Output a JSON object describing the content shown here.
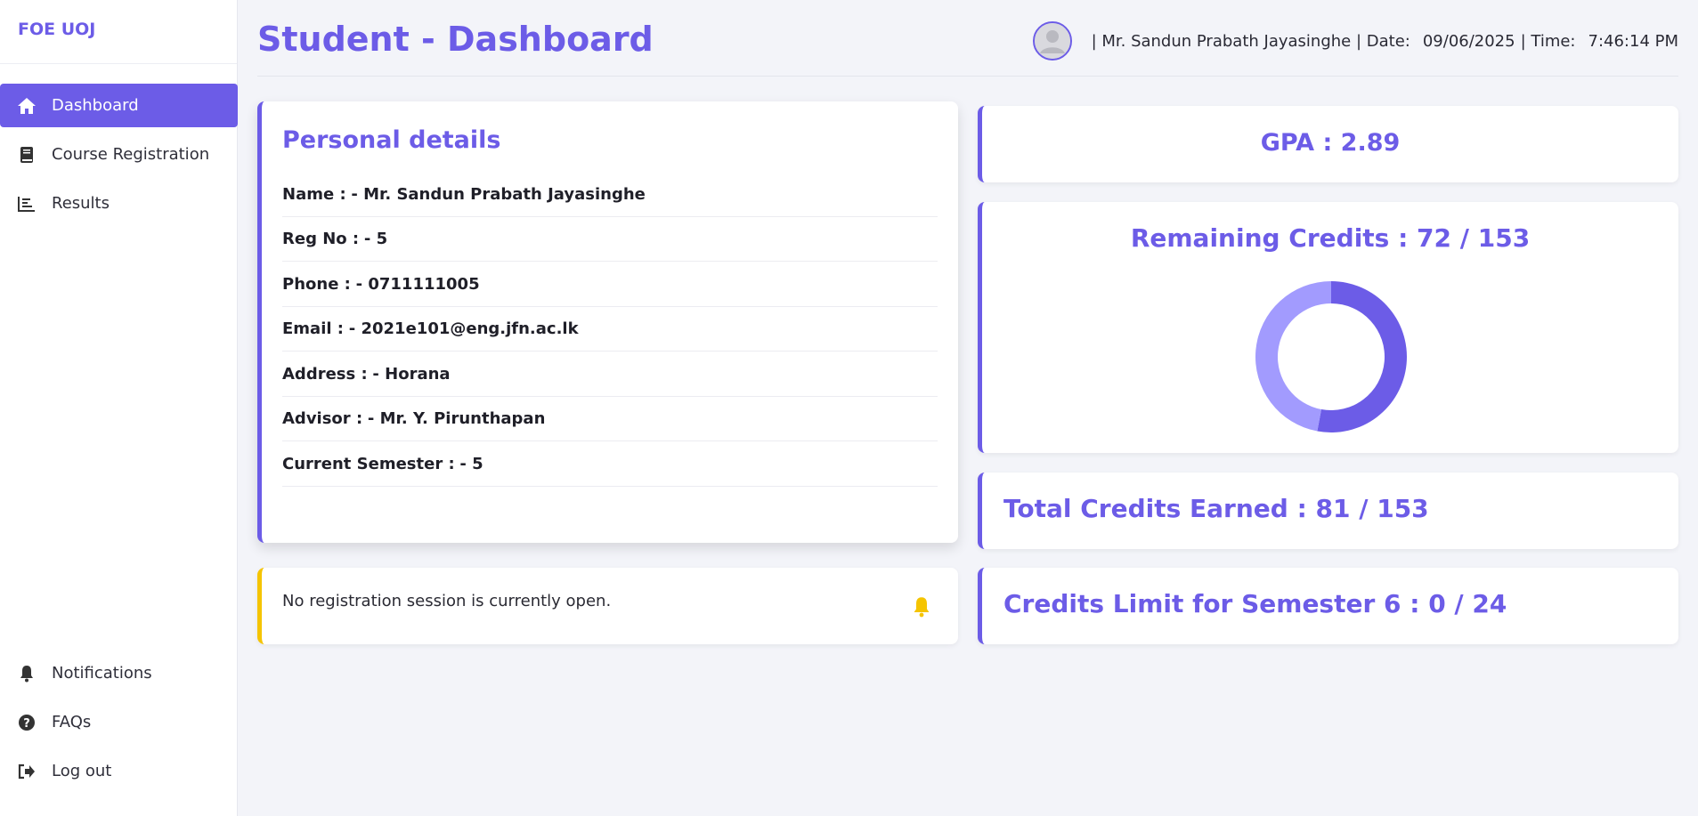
{
  "brand": "FOE UOJ",
  "sidebar": {
    "items": [
      {
        "label": "Dashboard",
        "icon": "home-icon"
      },
      {
        "label": "Course Registration",
        "icon": "book-icon"
      },
      {
        "label": "Results",
        "icon": "bar-chart-icon"
      }
    ],
    "bottom_items": [
      {
        "label": "Notifications",
        "icon": "bell-icon"
      },
      {
        "label": "FAQs",
        "icon": "question-circle-icon"
      },
      {
        "label": "Log out",
        "icon": "logout-icon"
      }
    ]
  },
  "header": {
    "title": "Student - Dashboard",
    "user_prefix": "| Mr. Sandun Prabath Jayasinghe",
    "date_label": " | Date:",
    "date_value": "09/06/2025",
    "time_label": "| Time:",
    "time_value": "7:46:14 PM"
  },
  "personal": {
    "title": "Personal details",
    "rows": [
      {
        "label": "Name :",
        "value": "- Mr. Sandun Prabath Jayasinghe"
      },
      {
        "label": "Reg No :",
        "value": "- 5"
      },
      {
        "label": "Phone :",
        "value": "- 0711111005"
      },
      {
        "label": "Email :",
        "value": "- 2021e101@eng.jfn.ac.lk"
      },
      {
        "label": "Address :",
        "value": "- Horana"
      },
      {
        "label": "Advisor :",
        "value": "- Mr. Y. Pirunthapan"
      },
      {
        "label": "Current Semester :",
        "value": "- 5"
      }
    ]
  },
  "notice": {
    "text": "No registration session is currently open."
  },
  "stats": {
    "gpa": "GPA : 2.89",
    "remaining": "Remaining Credits : 72 / 153",
    "earned": "Total Credits Earned : 81 / 153",
    "limit": "Credits Limit for Semester 6 : 0 / 24"
  },
  "colors": {
    "accent": "#6c5ce7",
    "accent_light": "#a29bfe",
    "warning": "#f5c400"
  },
  "credits": {
    "earned": 81,
    "remaining": 72,
    "total": 153
  }
}
